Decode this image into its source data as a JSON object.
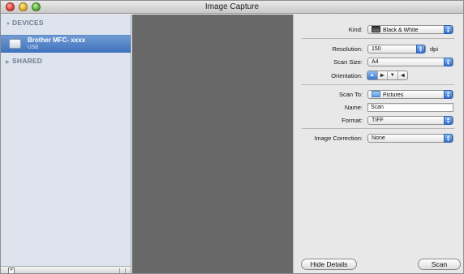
{
  "window": {
    "title": "Image Capture"
  },
  "sidebar": {
    "devices_header": "DEVICES",
    "shared_header": "SHARED",
    "device": {
      "name": "Brother MFC- xxxx",
      "connection": "USB"
    }
  },
  "panel": {
    "kind": {
      "label": "Kind:",
      "value": "Black & White"
    },
    "resolution": {
      "label": "Resolution:",
      "value": "150",
      "unit": "dpi"
    },
    "scan_size": {
      "label": "Scan Size:",
      "value": "A4"
    },
    "orientation": {
      "label": "Orientation:",
      "options": [
        "portrait-upright",
        "landscape-left",
        "portrait-down",
        "landscape-right"
      ],
      "selected": 0
    },
    "scan_to": {
      "label": "Scan To:",
      "value": "Pictures"
    },
    "name": {
      "label": "Name:",
      "value": "Scan"
    },
    "format": {
      "label": "Format:",
      "value": "TIFF"
    },
    "image_correction": {
      "label": "Image Correction:",
      "value": "None"
    }
  },
  "buttons": {
    "hide_details": "Hide Details",
    "scan": "Scan"
  },
  "colors": {
    "selection": "#3f72bd",
    "preview_bg": "#686868",
    "popup_accent": "#2f6fd1"
  }
}
